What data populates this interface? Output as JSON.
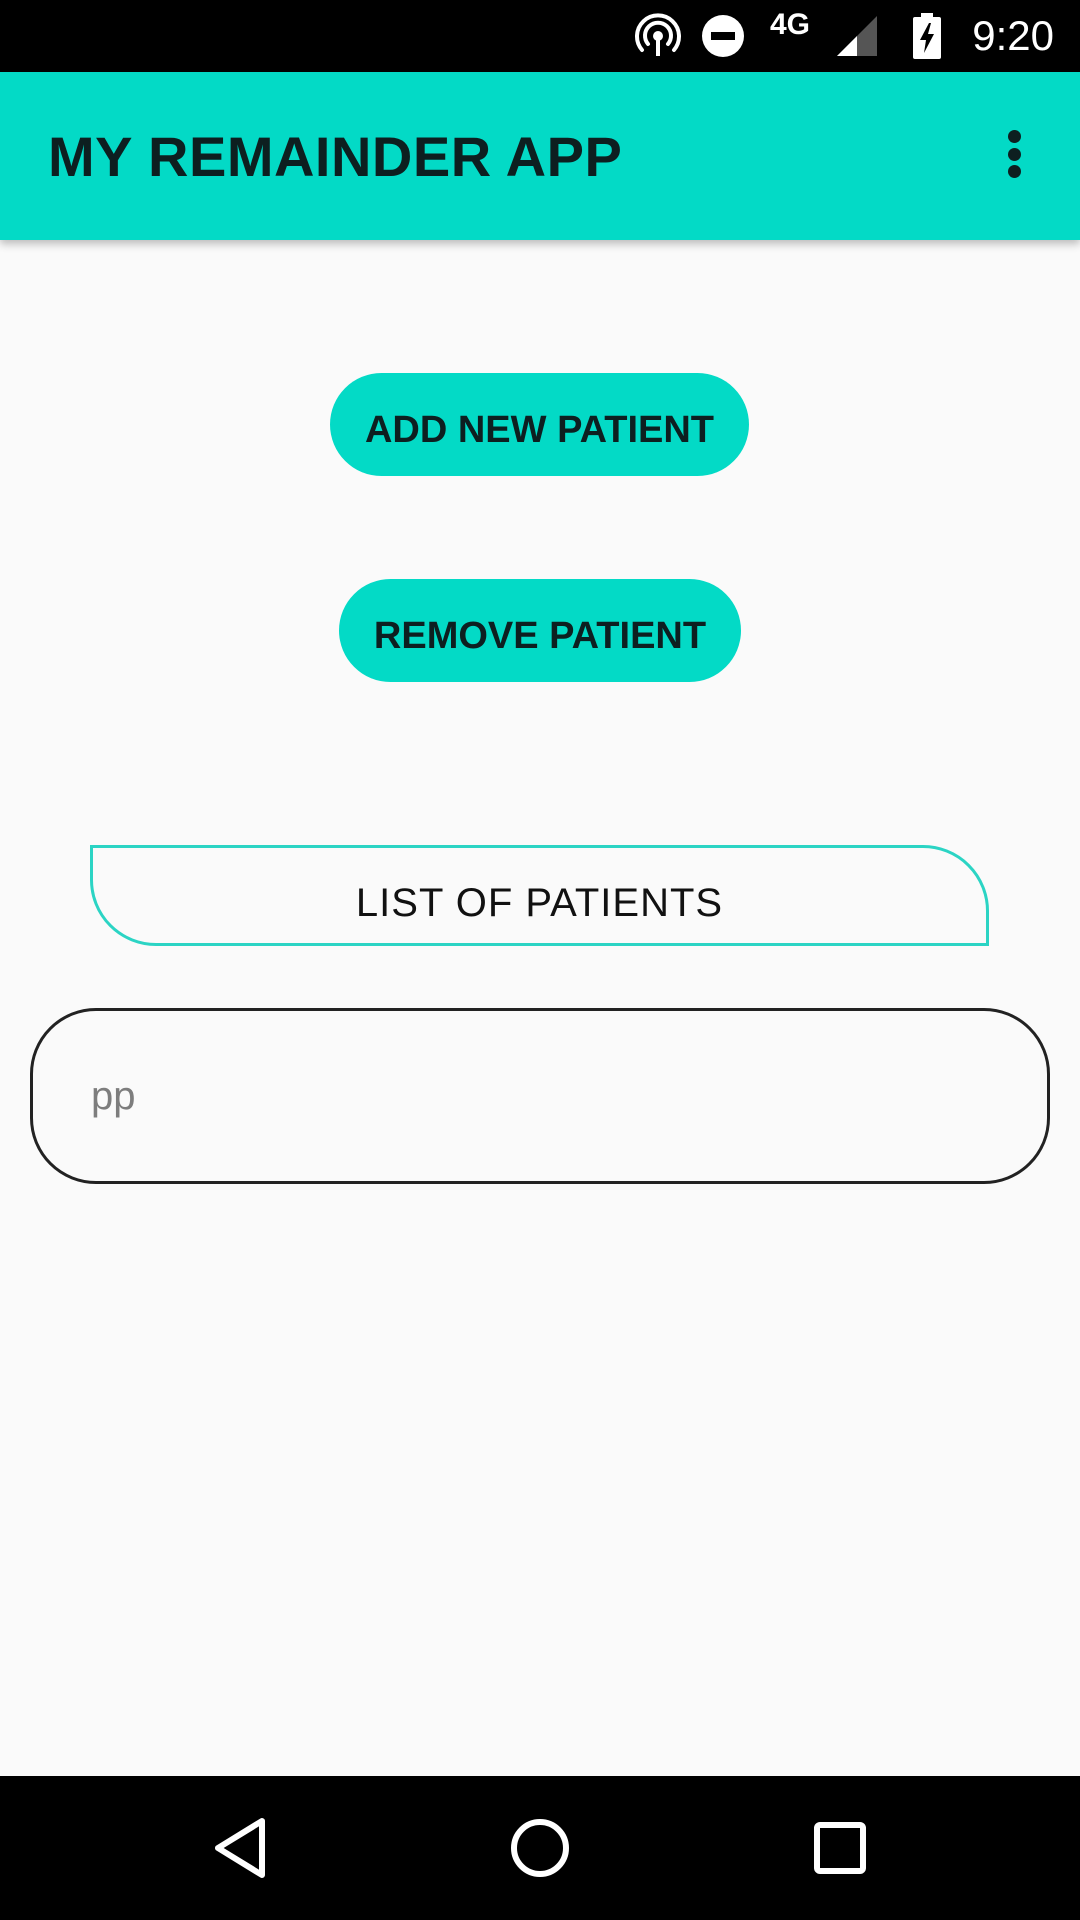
{
  "status_bar": {
    "network_label": "4G",
    "time": "9:20",
    "icons": [
      "hotspot-icon",
      "do-not-disturb-icon",
      "cell-signal-icon",
      "battery-charging-icon"
    ]
  },
  "app_bar": {
    "title": "MY REMAINDER APP",
    "overflow_icon": "more-vert-icon"
  },
  "main": {
    "add_button_label": "ADD NEW PATIENT",
    "remove_button_label": "REMOVE PATIENT",
    "list_header_label": "LIST OF PATIENTS",
    "patient_input": {
      "value": "",
      "placeholder": "pp"
    }
  },
  "nav_bar": {
    "icons": [
      "back-icon",
      "home-icon",
      "recents-icon"
    ]
  },
  "colors": {
    "accent": "#03dac6",
    "background": "#fafafa",
    "text_dark": "#0d1f20",
    "system_bars": "#000000"
  }
}
